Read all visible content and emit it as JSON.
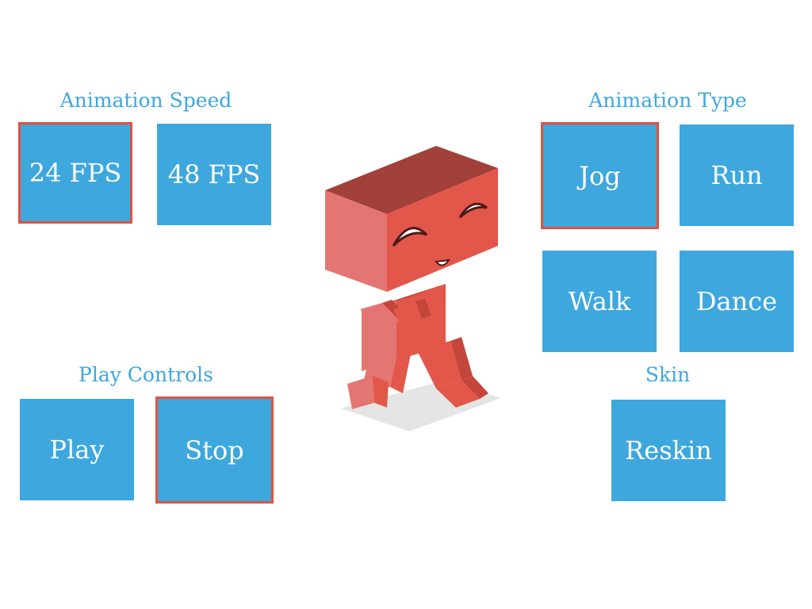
{
  "colors": {
    "accent": "#3ea7de",
    "selected_border": "#e2513f",
    "character": "#e2574a"
  },
  "animation_speed": {
    "title": "Animation Speed",
    "options": [
      {
        "label": "24 FPS",
        "selected": true
      },
      {
        "label": "48 FPS",
        "selected": false
      }
    ]
  },
  "animation_type": {
    "title": "Animation Type",
    "options": [
      {
        "label": "Jog",
        "selected": true
      },
      {
        "label": "Run",
        "selected": false
      },
      {
        "label": "Walk",
        "selected": false
      },
      {
        "label": "Dance",
        "selected": false
      }
    ]
  },
  "play_controls": {
    "title": "Play Controls",
    "options": [
      {
        "label": "Play",
        "selected": false
      },
      {
        "label": "Stop",
        "selected": true
      }
    ]
  },
  "skin": {
    "title": "Skin",
    "options": [
      {
        "label": "Reskin",
        "selected": false
      }
    ]
  },
  "character": {
    "icon": "box-robot-character-icon"
  }
}
